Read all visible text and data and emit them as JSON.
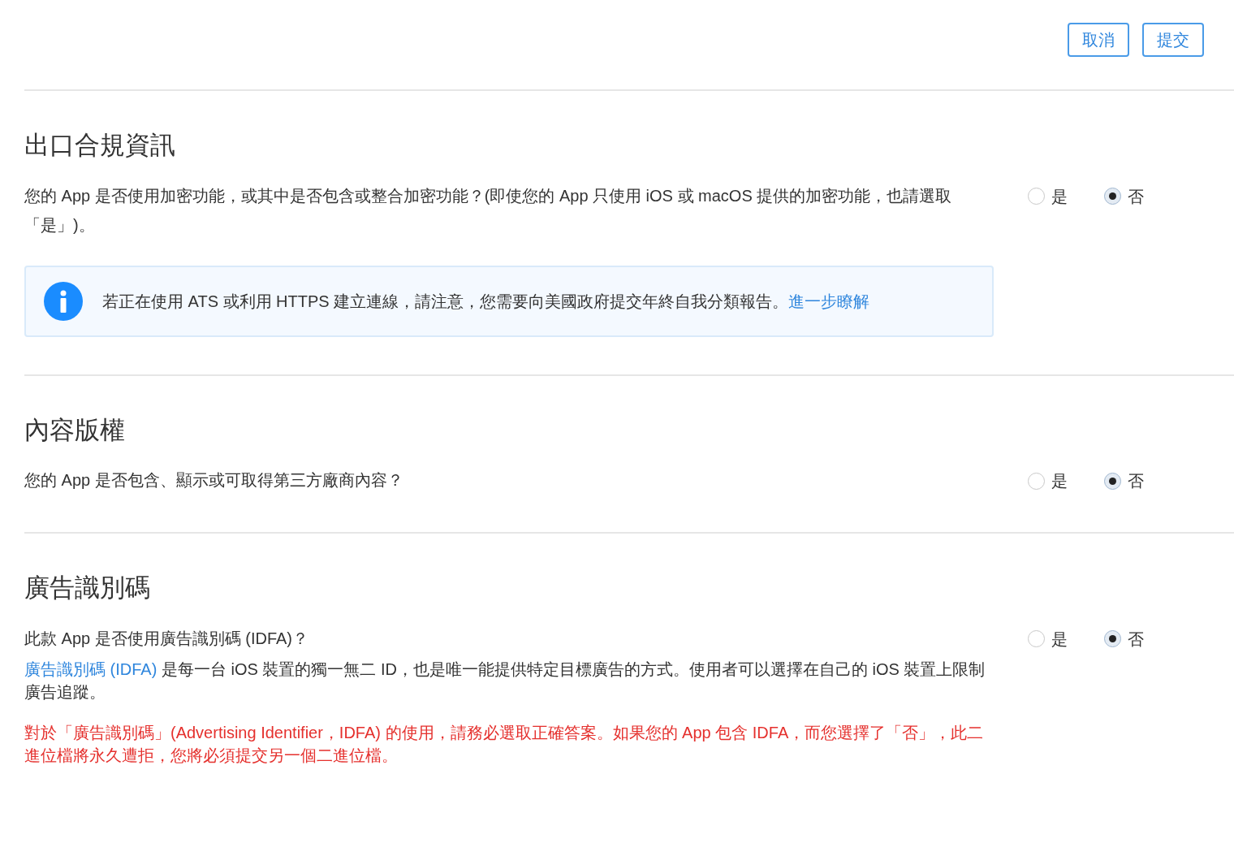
{
  "buttons": [
    {
      "label": "取消"
    },
    {
      "label": "提交"
    }
  ],
  "sections": [
    {
      "title": "出口合規資訊",
      "question": "您的 App 是否使用加密功能，或其中是否包含或整合加密功能？(即使您的 App 只使用 iOS 或 macOS 提供的加密功能，也請選取「是」)。",
      "options": [
        {
          "label": "是",
          "selected": false
        },
        {
          "label": "否",
          "selected": true
        }
      ],
      "notice": {
        "text": "若正在使用 ATS 或利用 HTTPS 建立連線，請注意，您需要向美國政府提交年終自我分類報告。",
        "link": "進一步瞭解"
      }
    },
    {
      "title": "內容版權",
      "question": "您的 App 是否包含、顯示或可取得第三方廠商內容？",
      "options": [
        {
          "label": "是",
          "selected": false
        },
        {
          "label": "否",
          "selected": true
        }
      ]
    },
    {
      "title": "廣告識別碼",
      "question": "此款 App 是否使用廣告識別碼 (IDFA)？",
      "options": [
        {
          "label": "是",
          "selected": false
        },
        {
          "label": "否",
          "selected": true
        }
      ],
      "description": {
        "link": "廣告識別碼 (IDFA)",
        "text": " 是每一台 iOS 裝置的獨一無二 ID，也是唯一能提供特定目標廣告的方式。使用者可以選擇在自己的 iOS 裝置上限制廣告追蹤。"
      },
      "warning": "對於「廣告識別碼」(Advertising Identifier，IDFA) 的使用，請務必選取正確答案。如果您的 App 包含 IDFA，而您選擇了「否」，此二進位檔將永久遭拒，您將必須提交另一個二進位檔。"
    }
  ]
}
